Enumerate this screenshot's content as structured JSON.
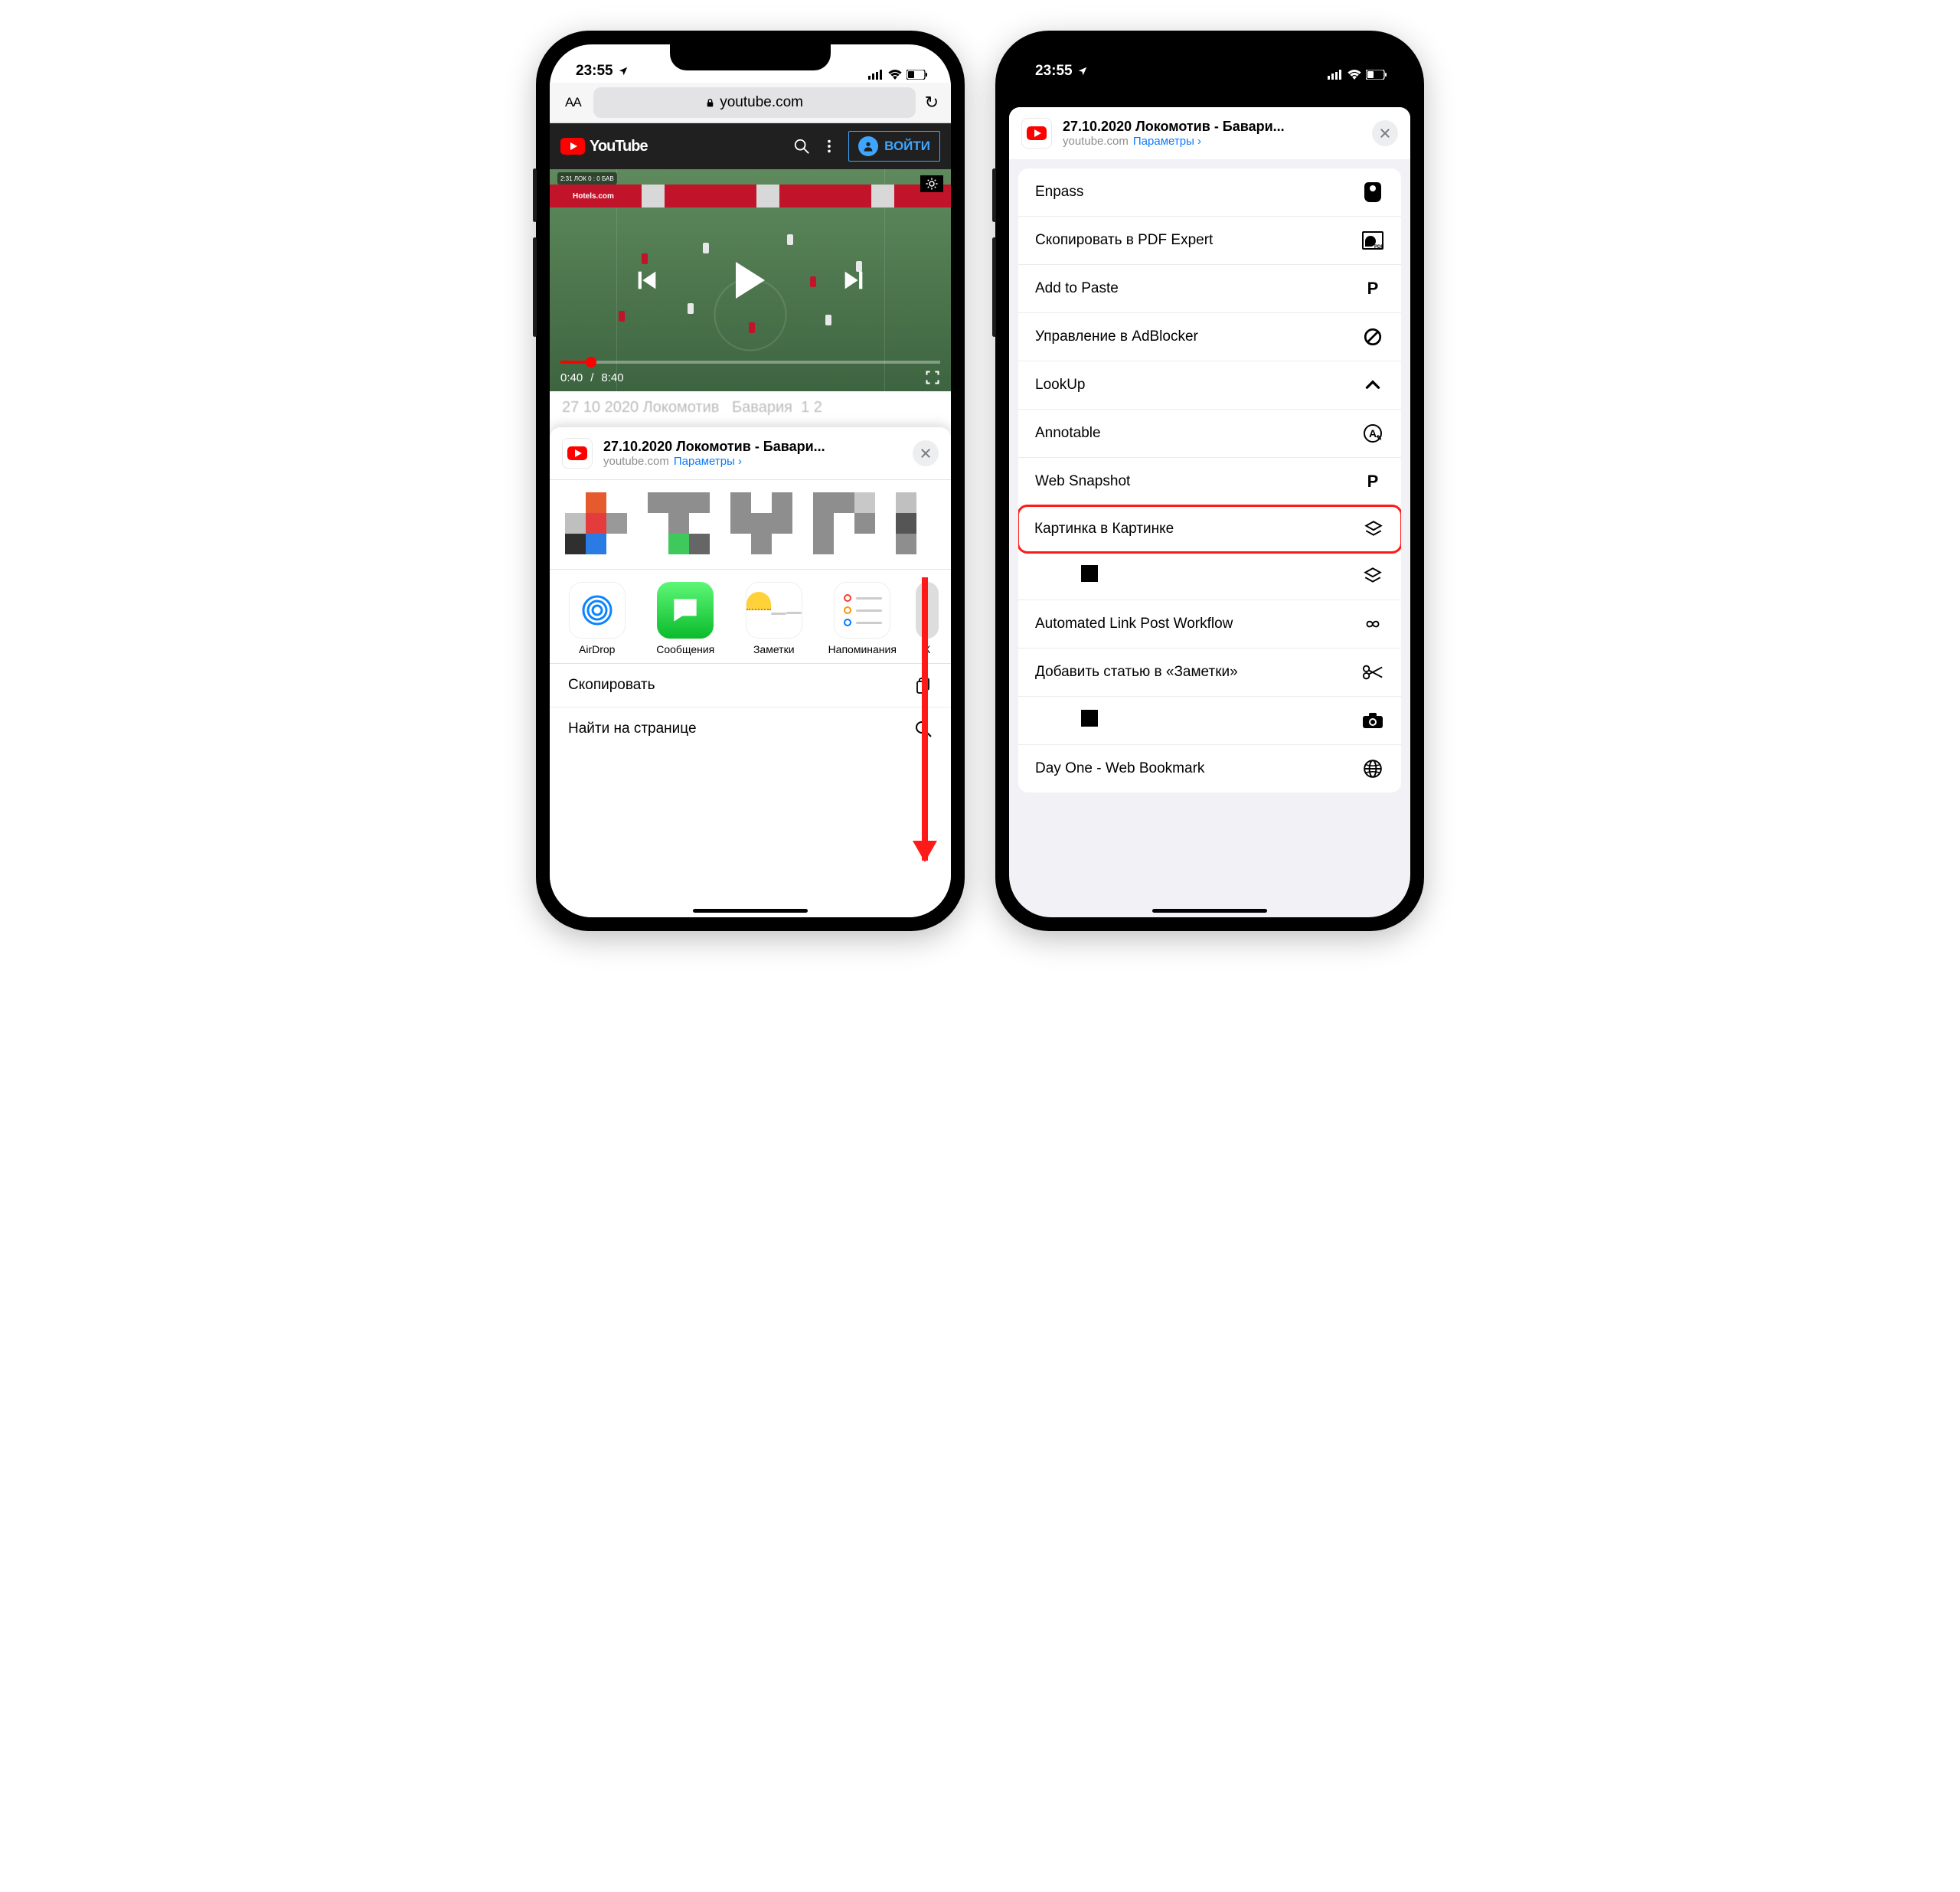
{
  "status": {
    "time": "23:55",
    "signal": "▮▮▮▮",
    "wifi": "wifi",
    "battery": "low"
  },
  "left": {
    "address": {
      "domain": "youtube.com"
    },
    "ytHeader": {
      "brand": "YouTube",
      "signin": "ВОЙТИ"
    },
    "video": {
      "score": "2:31  ЛОК 0 : 0 БАВ",
      "banner": "Hotels.com",
      "timeCurrent": "0:40",
      "timeTotal": "8:40"
    },
    "hiddenTitle": "27.10.2020 Локомотив - Бавария 1-2",
    "share": {
      "title": "27.10.2020 Локомотив - Бавари...",
      "domain": "youtube.com",
      "options": "Параметры",
      "apps": [
        {
          "label": "AirDrop"
        },
        {
          "label": "Сообщения"
        },
        {
          "label": "Заметки"
        },
        {
          "label": "Напоминания"
        },
        {
          "label": "К"
        }
      ],
      "actions": [
        {
          "label": "Скопировать",
          "icon": "copy"
        },
        {
          "label": "Найти на странице",
          "icon": "search"
        }
      ]
    }
  },
  "right": {
    "share": {
      "title": "27.10.2020 Локомотив - Бавари...",
      "domain": "youtube.com",
      "options": "Параметры"
    },
    "shortcuts": [
      {
        "label": "Enpass",
        "icon": "enpass"
      },
      {
        "label": "Скопировать в PDF Expert",
        "icon": "pdf"
      },
      {
        "label": "Add to Paste",
        "icon": "paste"
      },
      {
        "label": "Управление в AdBlocker",
        "icon": "block"
      },
      {
        "label": "LookUp",
        "icon": "chevron"
      },
      {
        "label": "Annotable",
        "icon": "annotable"
      },
      {
        "label": "Web Snapshot",
        "icon": "snapshot"
      },
      {
        "label": "Картинка в Картинке",
        "icon": "layers",
        "highlight": true
      },
      {
        "label": "",
        "icon": "layers",
        "blank": true
      },
      {
        "label": "Automated Link Post Workflow",
        "icon": "infinity"
      },
      {
        "label": "Добавить статью в «Заметки»",
        "icon": "scissors"
      },
      {
        "label": "",
        "icon": "camera",
        "blank": true
      },
      {
        "label": "Day One - Web Bookmark",
        "icon": "globe"
      }
    ]
  }
}
